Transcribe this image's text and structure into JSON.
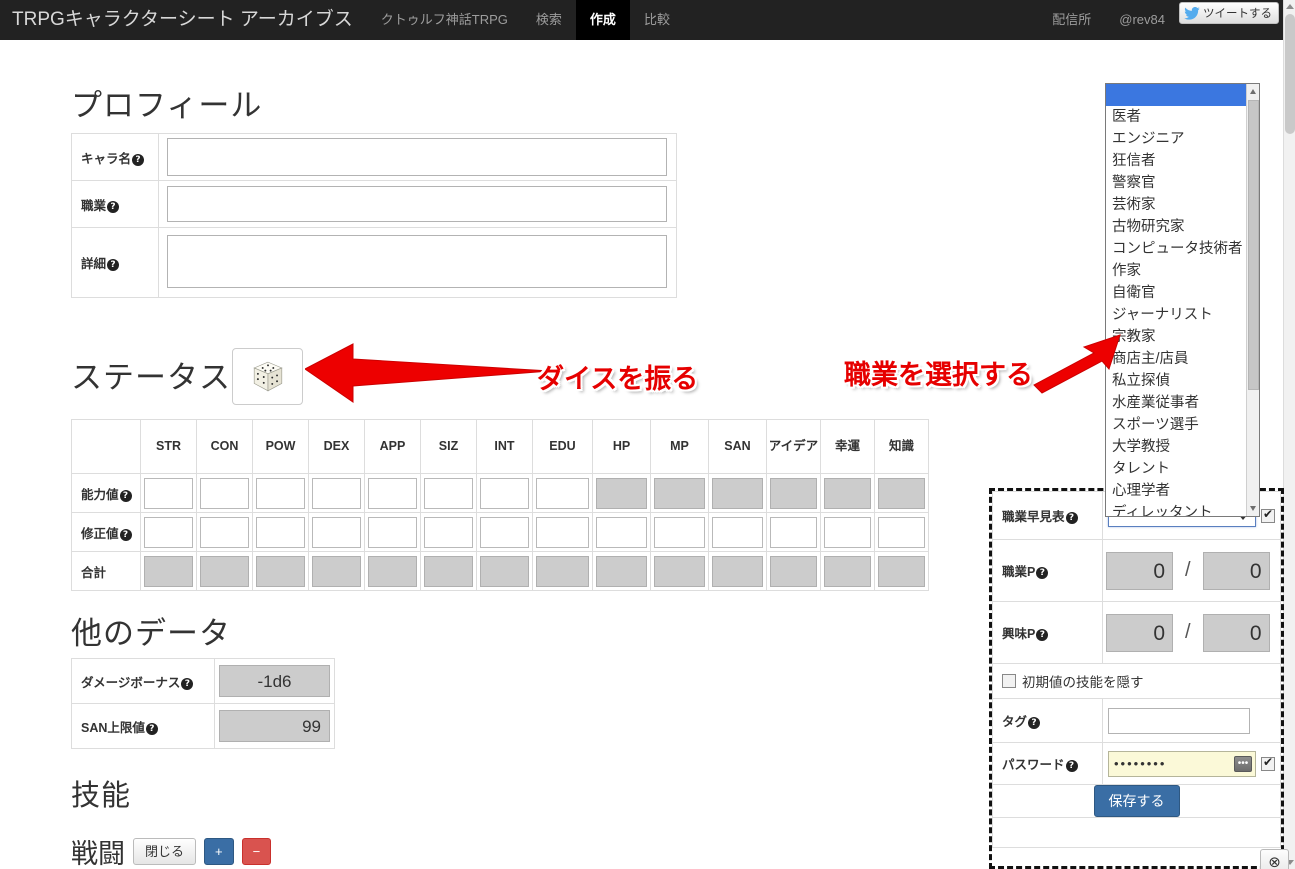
{
  "navbar": {
    "brand": "TRPGキャラクターシート アーカイブス",
    "items": [
      {
        "label": "クトゥルフ神話TRPG",
        "active": false
      },
      {
        "label": "検索",
        "active": false
      },
      {
        "label": "作成",
        "active": true
      },
      {
        "label": "比較",
        "active": false
      }
    ],
    "right_items": [
      {
        "label": "配信所"
      },
      {
        "label": "@rev84"
      }
    ],
    "tweet_button": "ツイートする"
  },
  "profile": {
    "heading": "プロフィール",
    "rows": [
      {
        "label": "キャラ名",
        "help": "?",
        "value": "",
        "type": "input"
      },
      {
        "label": "職業",
        "help": "?",
        "value": "",
        "type": "input"
      },
      {
        "label": "詳細",
        "help": "?",
        "value": "",
        "type": "textarea"
      }
    ]
  },
  "status": {
    "heading": "ステータス",
    "dice_button": "dice-icon",
    "columns": [
      "STR",
      "CON",
      "POW",
      "DEX",
      "APP",
      "SIZ",
      "INT",
      "EDU",
      "HP",
      "MP",
      "SAN",
      "アイデア",
      "幸運",
      "知識"
    ],
    "rows": [
      {
        "label": "能力値",
        "help": "?",
        "values": [
          "",
          "",
          "",
          "",
          "",
          "",
          "",
          "",
          "",
          "",
          "",
          "",
          "",
          ""
        ],
        "readonly": [
          false,
          false,
          false,
          false,
          false,
          false,
          false,
          false,
          true,
          true,
          true,
          true,
          true,
          true
        ]
      },
      {
        "label": "修正値",
        "help": "?",
        "values": [
          "",
          "",
          "",
          "",
          "",
          "",
          "",
          "",
          "",
          "",
          "",
          "",
          "",
          ""
        ],
        "readonly": [
          false,
          false,
          false,
          false,
          false,
          false,
          false,
          false,
          false,
          false,
          false,
          false,
          false,
          false
        ]
      },
      {
        "label": "合計",
        "help": "",
        "values": [
          "",
          "",
          "",
          "",
          "",
          "",
          "",
          "",
          "",
          "",
          "",
          "",
          "",
          ""
        ],
        "readonly": [
          true,
          true,
          true,
          true,
          true,
          true,
          true,
          true,
          true,
          true,
          true,
          true,
          true,
          true
        ]
      }
    ]
  },
  "other_data": {
    "heading": "他のデータ",
    "rows": [
      {
        "label": "ダメージボーナス",
        "help": "?",
        "value": "-1d6",
        "align": "center"
      },
      {
        "label": "SAN上限値",
        "help": "?",
        "value": "99",
        "align": "right"
      }
    ]
  },
  "skills": {
    "heading": "技能",
    "category": "戦闘",
    "close_button": "閉じる",
    "add_button": "+",
    "remove_button": "−"
  },
  "occupation_list": {
    "options": [
      "",
      "医者",
      "エンジニア",
      "狂信者",
      "警察官",
      "芸術家",
      "古物研究家",
      "コンピュータ技術者",
      "作家",
      "自衛官",
      "ジャーナリスト",
      "宗教家",
      "商店主/店員",
      "私立探偵",
      "水産業従事者",
      "スポーツ選手",
      "大学教授",
      "タレント",
      "心理学者",
      "ディレッタント"
    ],
    "selected_index": 0
  },
  "right_panel": {
    "rows": [
      {
        "label": "職業早見表",
        "help": "?",
        "type": "select",
        "value": "",
        "checkbox_checked": true
      },
      {
        "label": "職業P",
        "help": "?",
        "type": "points",
        "current": "0",
        "separator": "/",
        "max": "0"
      },
      {
        "label": "興味P",
        "help": "?",
        "type": "points",
        "current": "0",
        "separator": "/",
        "max": "0"
      },
      {
        "label": "初期値の技能を隠す",
        "help": "",
        "type": "checkbox",
        "checked": false
      },
      {
        "label": "タグ",
        "help": "?",
        "type": "input",
        "value": ""
      },
      {
        "label": "パスワード",
        "help": "?",
        "type": "password",
        "value": "••••••••",
        "checkbox_checked": true
      }
    ],
    "save_button": "保存する",
    "close_button": "⊗"
  },
  "annotations": [
    {
      "text": "ダイスを振る",
      "target": "dice-button"
    },
    {
      "text": "職業を選択する",
      "target": "occupation-list"
    }
  ],
  "colors": {
    "navbar_bg": "#222222",
    "nav_active_bg": "#000000",
    "annotation_red": "#e60000",
    "primary_blue": "#3a6ea5",
    "danger_red": "#d9534f",
    "select_highlight": "#3b77e0",
    "readonly_gray": "#cccccc",
    "password_field": "#fbf9d8"
  }
}
